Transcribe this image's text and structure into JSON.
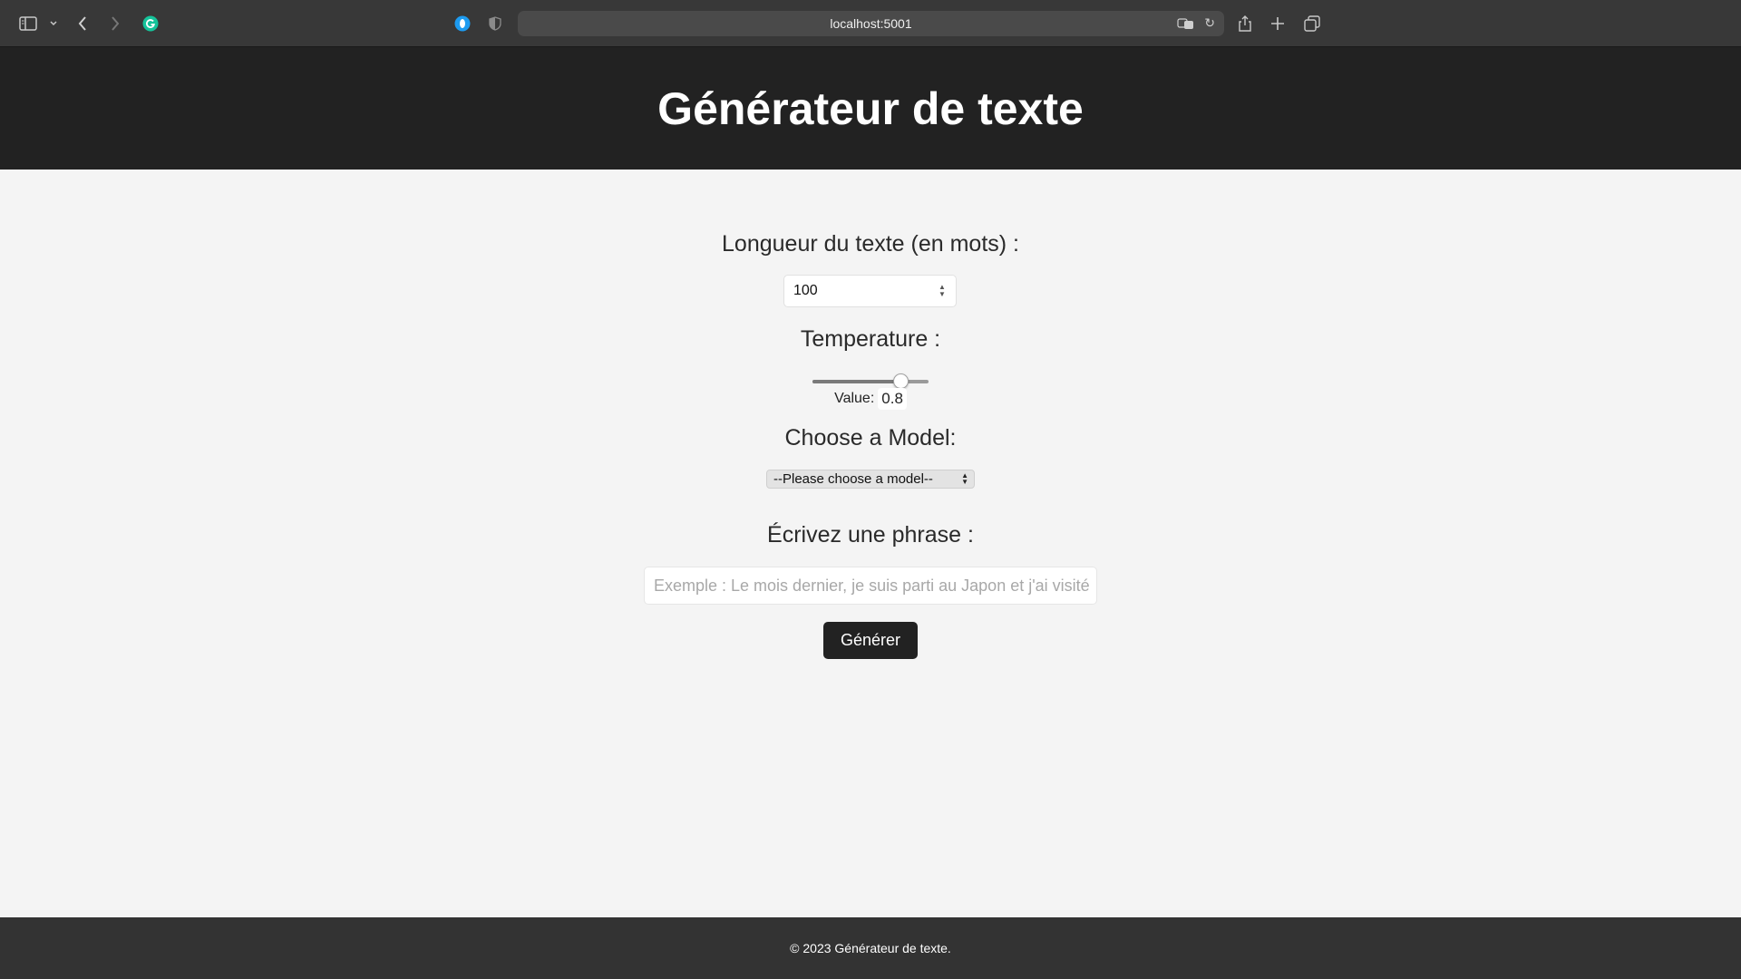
{
  "browser": {
    "url": "localhost:5001",
    "icons": {
      "sidebar": "sidebar-icon",
      "sidebar_menu": "chevron-down-icon",
      "back": "back-arrow-icon",
      "forward": "forward-arrow-icon",
      "extension": "grammarly-icon",
      "privacy": "privacy-icon",
      "shield": "shield-icon",
      "translate": "translate-icon",
      "reload": "reload-icon",
      "share": "share-icon",
      "new_tab": "plus-icon",
      "tabs": "tabs-overview-icon"
    }
  },
  "header": {
    "title": "Générateur de texte"
  },
  "form": {
    "length_label": "Longueur du texte (en mots) :",
    "length_value": "100",
    "temperature_label": "Temperature :",
    "temperature_value_prefix": "Value:",
    "temperature_value": "0.8",
    "temperature_fraction": 0.8,
    "model_label": "Choose a Model:",
    "model_selected": "--Please choose a model--",
    "phrase_label": "Écrivez une phrase :",
    "phrase_placeholder": "Exemple : Le mois dernier, je suis parti au Japon et j'ai visité",
    "generate_label": "Générer"
  },
  "footer": {
    "text": "© 2023 Générateur de texte."
  },
  "colors": {
    "header_bg": "#222222",
    "page_bg": "#f4f4f4",
    "footer_bg": "#333333",
    "button_bg": "#222222",
    "extension_green": "#15c39a",
    "privacy_blue": "#1d9bf0"
  }
}
